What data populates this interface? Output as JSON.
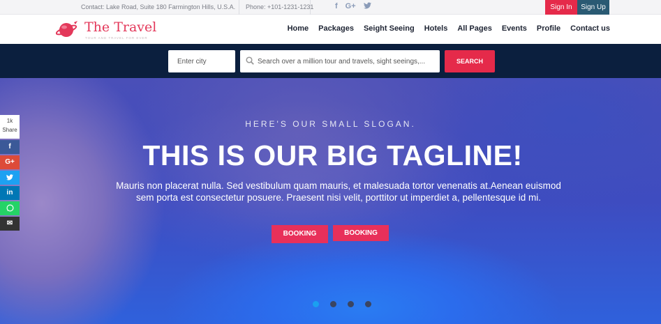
{
  "topbar": {
    "contact": "Contact: Lake Road, Suite 180 Farmington Hills, U.S.A.",
    "phone": "Phone: +101-1231-1231",
    "social": {
      "facebook": "f",
      "googleplus": "G+",
      "twitter": "t"
    },
    "signin": "Sign In",
    "signup": "Sign Up"
  },
  "logo": {
    "name": "The Travel",
    "tagline": "TOUR AND TRAVEL FOR EVER"
  },
  "nav": {
    "items": [
      "Home",
      "Packages",
      "Seight Seeing",
      "Hotels",
      "All Pages",
      "Events",
      "Profile",
      "Contact us"
    ]
  },
  "search": {
    "city_placeholder": "Enter city",
    "query_placeholder": "Search over a million tour and travels, sight seeings,...",
    "button": "SEARCH"
  },
  "hero": {
    "slogan": "HERE'S OUR SMALL SLOGAN.",
    "tagline": "THIS IS OUR BIG TAGLINE!",
    "paragraph": "Mauris non placerat nulla. Sed vestibulum quam mauris, et malesuada tortor venenatis at.Aenean euismod sem porta est consectetur posuere. Praesent nisi velit, porttitor ut imperdiet a, pellentesque id mi.",
    "booking_1": "BOOKING",
    "booking_2": "BOOKING",
    "slides": 4,
    "active_slide": 1
  },
  "share": {
    "count": "1k",
    "label": "Share",
    "facebook": "f",
    "googleplus": "G+",
    "twitter": "t",
    "linkedin": "in",
    "whatsapp": "w",
    "email": "✉"
  },
  "colors": {
    "accent": "#e52a4a",
    "navy": "#0b1f3e",
    "signup": "#2a5a73"
  }
}
